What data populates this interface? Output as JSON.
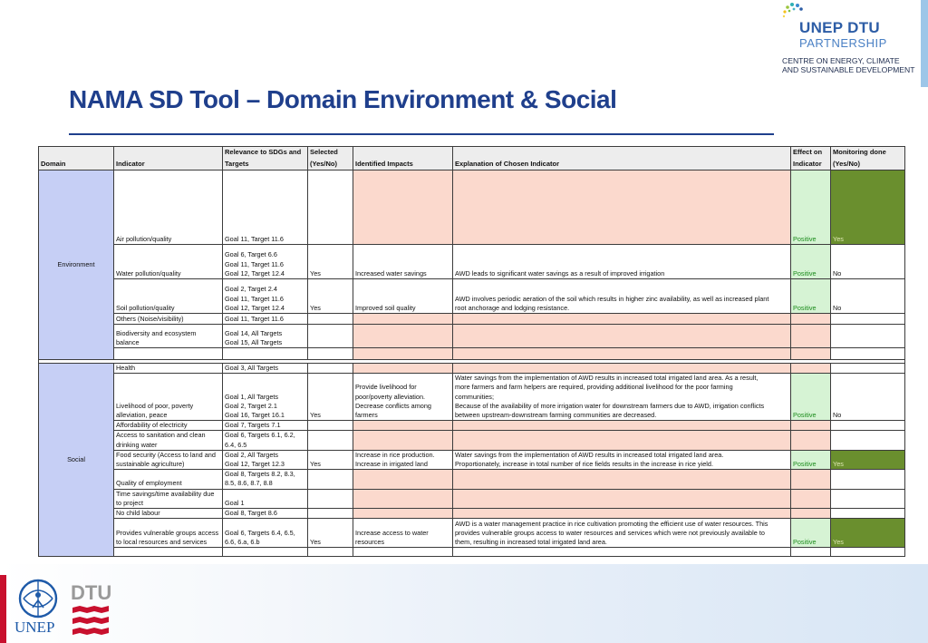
{
  "partner_logo": {
    "line1": "UNEP DTU",
    "line2": "PARTNERSHIP",
    "line3": "CENTRE ON ENERGY, CLIMATE",
    "line4": "AND SUSTAINABLE DEVELOPMENT"
  },
  "title": "NAMA SD Tool – Domain Environment & Social",
  "table": {
    "headers": {
      "domain": "Domain",
      "indicator": "Indicator",
      "relevance": [
        "Relevance to SDGs and",
        "Targets"
      ],
      "selected": [
        "Selected",
        "(Yes/No)"
      ],
      "impacts": "Identified Impacts",
      "explanation": "Explanation of Chosen Indicator",
      "effect": [
        "Effect on",
        "Indicator"
      ],
      "monitoring": [
        "Monitoring done",
        "(Yes/No)"
      ]
    },
    "environment": {
      "domain": "Environment",
      "rows": [
        {
          "indicator": "Air pollution/quality",
          "relevance": [
            "Goal 11, Target 11.6"
          ],
          "selected": "",
          "impacts": [],
          "explanation": [],
          "effect": "Positive",
          "monitoring": "Yes"
        },
        {
          "indicator": "Water pollution/quality",
          "relevance": [
            "Goal 6, Target 6.6",
            "Goal 11, Target 11.6",
            "Goal 12, Target 12.4"
          ],
          "selected": "Yes",
          "impacts": [
            "Increased water savings"
          ],
          "explanation": [
            "AWD leads to significant water savings as a result of improved irrigation"
          ],
          "effect": "Positive",
          "monitoring": "No"
        },
        {
          "indicator": "Soil pollution/quality",
          "relevance": [
            "Goal 2, Target 2.4",
            "Goal 11, Target 11.6",
            "Goal 12, Target 12.4"
          ],
          "selected": "Yes",
          "impacts": [
            "Improved soil quality"
          ],
          "explanation": [
            "AWD involves periodic aeration of the soil which results in higher zinc availability, as well as increased plant",
            "root anchorage and lodging resistance."
          ],
          "effect": "Positive",
          "monitoring": "No"
        },
        {
          "indicator": "Others (Noise/visibility)",
          "relevance": [
            "Goal 11, Target 11.6"
          ],
          "selected": "",
          "impacts": [],
          "explanation": [],
          "effect": "",
          "monitoring": ""
        },
        {
          "indicator": [
            "Biodiversity and ecosystem",
            "balance"
          ],
          "relevance": [
            "Goal 14, All Targets",
            "Goal 15, All Targets"
          ],
          "selected": "",
          "impacts": [],
          "explanation": [],
          "effect": "",
          "monitoring": ""
        }
      ]
    },
    "social": {
      "domain": "Social",
      "rows": [
        {
          "indicator": [
            "Health"
          ],
          "relevance": [
            "Goal 3, All Targets"
          ],
          "selected": "",
          "impacts": [],
          "explanation": [],
          "effect": "",
          "monitoring": ""
        },
        {
          "indicator": [
            "Livelihood of poor, poverty",
            "alleviation, peace"
          ],
          "relevance": [
            "Goal 1, All Targets",
            "Goal 2, Target 2.1",
            "Goal 16, Target 16.1"
          ],
          "selected": "Yes",
          "impacts": [
            "Provide livelihood for",
            "poor/poverty alleviation.",
            "Decrease conflicts among",
            "farmers"
          ],
          "explanation": [
            "Water savings from the implementation of AWD results in increased total irrigated land area. As a result,",
            "more farmers and farm helpers are required, providing additional livelihood for the poor farming",
            "communities;",
            "Because of the availability of more irrigation water for downstream farmers due to AWD, irrigation conflicts",
            "between upstream-downstream farming communities are decreased."
          ],
          "effect": "Positive",
          "monitoring": "No"
        },
        {
          "indicator": [
            "Affordability of electricity"
          ],
          "relevance": [
            "Goal 7, Targets 7.1"
          ],
          "selected": "",
          "impacts": [],
          "explanation": [],
          "effect": "",
          "monitoring": ""
        },
        {
          "indicator": [
            "Access to sanitation and clean",
            "drinking water"
          ],
          "relevance": [
            "Goal 6,  Targets 6.1, 6.2,",
            "6.4, 6.5"
          ],
          "selected": "",
          "impacts": [],
          "explanation": [],
          "effect": "",
          "monitoring": ""
        },
        {
          "indicator": [
            "Food security (Access to land and",
            "sustainable agriculture)"
          ],
          "relevance": [
            "Goal 2, All Targets",
            "Goal 12, Target 12.3"
          ],
          "selected": "Yes",
          "impacts": [
            "Increase in rice production.",
            "Increase in irrigated land"
          ],
          "explanation": [
            "Water savings from the implementation of AWD results in increased total irrigated land area.",
            "Proportionately, increase in total number of rice fields results in the increase in rice yield."
          ],
          "effect": "Positive",
          "monitoring": "Yes"
        },
        {
          "indicator": [
            "Quality of employment"
          ],
          "relevance": [
            "Goal 8, Targets 8.2, 8.3,",
            "8.5, 8.6, 8.7, 8.8"
          ],
          "selected": "",
          "impacts": [],
          "explanation": [],
          "effect": "",
          "monitoring": ""
        },
        {
          "indicator": [
            "Time savings/time availability due",
            "to project"
          ],
          "relevance": [
            "Goal 1"
          ],
          "selected": "",
          "impacts": [],
          "explanation": [],
          "effect": "",
          "monitoring": ""
        },
        {
          "indicator": [
            "No child labour"
          ],
          "relevance": [
            "Goal 8, Target 8.6"
          ],
          "selected": "",
          "impacts": [],
          "explanation": [],
          "effect": "",
          "monitoring": ""
        },
        {
          "indicator": [
            "Provides vulnerable groups access",
            "to local resources and services"
          ],
          "relevance": [
            "Goal 6, Targets 6.4, 6.5,",
            "6.6, 6.a, 6.b"
          ],
          "selected": "Yes",
          "impacts": [
            "Increase access to water",
            "resources"
          ],
          "explanation": [
            "AWD is a water management practice in rice cultivation promoting the efficient use of water resources. This",
            "provides vulnerable groups access to water resources and services which were not previously available to",
            "them, resulting in increased total irrigated land area."
          ],
          "effect": "Positive",
          "monitoring": "Yes"
        }
      ]
    }
  },
  "footer": {
    "unep": "UNEP",
    "dtu": "DTU"
  },
  "colors": {
    "title": "#1f3f8c",
    "domain_cell": "#c6cff5",
    "impact_cell": "#fbd9cd",
    "effect_cell": "#d6f3d4",
    "monitoring_yes": "#6a8f2e",
    "unep_red": "#c8102e"
  }
}
